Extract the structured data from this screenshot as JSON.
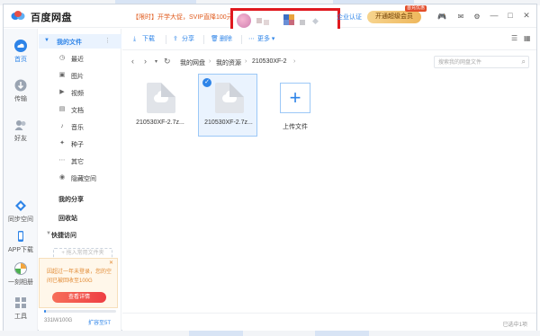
{
  "app": {
    "title": "百度网盘"
  },
  "header": {
    "promo": "【限时】开学大促，SVIP直降100元",
    "enterprise_label": "企业认证",
    "open_vip_label": "开通超级会员",
    "vip_badge": "首充优惠"
  },
  "nav": {
    "items": [
      {
        "label": "首页",
        "icon": "cloud-icon"
      },
      {
        "label": "传输",
        "icon": "transfer-icon"
      },
      {
        "label": "好友",
        "icon": "friends-icon"
      },
      {
        "label": "同步空间",
        "icon": "sync-icon"
      },
      {
        "label": "APP下载",
        "icon": "phone-icon"
      },
      {
        "label": "一刻相册",
        "icon": "album-icon"
      },
      {
        "label": "工具",
        "icon": "tools-icon"
      }
    ]
  },
  "folders": {
    "my_files": "我的文件",
    "categories": [
      {
        "label": "最近",
        "icon": "clock-icon"
      },
      {
        "label": "图片",
        "icon": "image-icon"
      },
      {
        "label": "视频",
        "icon": "video-icon"
      },
      {
        "label": "文档",
        "icon": "document-icon"
      },
      {
        "label": "音乐",
        "icon": "music-icon"
      },
      {
        "label": "种子",
        "icon": "seed-icon"
      },
      {
        "label": "其它",
        "icon": "other-icon"
      },
      {
        "label": "隐藏空间",
        "icon": "hidden-icon"
      }
    ],
    "my_share": "我的分享",
    "recycle": "回收站",
    "quick_access": "快捷访问",
    "quick_add": "+ 拖入常用文件夹",
    "notice_text": "因超过一年未登录，您的空间已被回收至100G",
    "notice_button": "查看详情",
    "storage_text": "331M/100G",
    "storage_fraction": 0.004,
    "expand_label": "扩容至5T"
  },
  "toolbar": {
    "download": "下载",
    "share": "分享",
    "delete": "删除",
    "more": "更多"
  },
  "path": {
    "crumbs": [
      "我的网盘",
      "我的资源",
      "210530XF-2"
    ],
    "search_placeholder": "搜索我的网盘文件"
  },
  "files": [
    {
      "name": "210530XF-2.7z...",
      "selected": false
    },
    {
      "name": "210530XF-2.7z...",
      "selected": true
    }
  ],
  "upload_label": "上传文件",
  "status": {
    "selection": "已选中1项"
  },
  "colors": {
    "accent": "#2e84e8",
    "highlight_box": "#e0191f"
  }
}
